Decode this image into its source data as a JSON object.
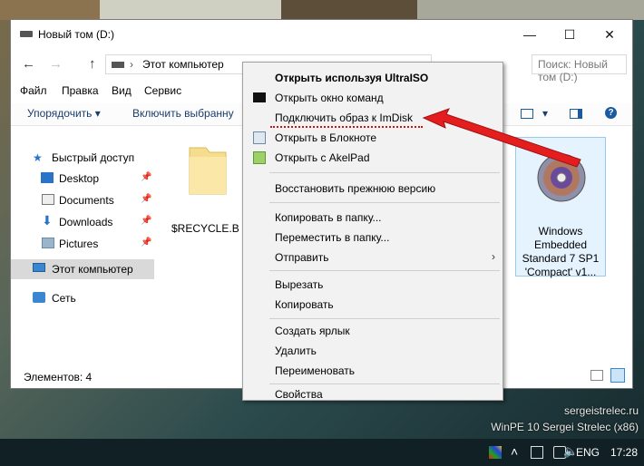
{
  "window": {
    "title": "Новый том (D:)",
    "controls": {
      "minimize": "—",
      "maximize": "☐",
      "close": "✕"
    }
  },
  "navigation": {
    "back": "←",
    "forward": "→",
    "up": "↑",
    "address_parts": [
      "Этот компьютер",
      "Новый том (D:)"
    ],
    "address_sep": "›",
    "search_placeholder": "Поиск: Новый том (D:)"
  },
  "menubar": [
    "Файл",
    "Правка",
    "Вид",
    "Сервис"
  ],
  "toolbar": {
    "organize": "Упорядочить",
    "include": "Включить выбранну"
  },
  "navpane": {
    "quick_access": "Быстрый доступ",
    "items": [
      {
        "label": "Desktop",
        "icon": "desktop-icon"
      },
      {
        "label": "Documents",
        "icon": "documents-icon"
      },
      {
        "label": "Downloads",
        "icon": "downloads-icon"
      },
      {
        "label": "Pictures",
        "icon": "pictures-icon"
      }
    ],
    "this_pc": "Этот компьютер",
    "network": "Сеть"
  },
  "content": {
    "folder_label": "$RECYCLE.B",
    "file_label_lines": [
      "Windows",
      "Embedded",
      "Standard 7 SP1",
      "'Compact' v1..."
    ]
  },
  "statusbar": {
    "items": "Элементов: 4"
  },
  "context_menu": {
    "items": [
      {
        "label": "Открыть используя UltraISO",
        "bold": true,
        "icon": null
      },
      {
        "label": "Открыть окно команд",
        "icon": "cmd-icon"
      },
      {
        "label": "Подключить образ к ImDisk",
        "icon": null,
        "highlighted": true
      },
      {
        "label": "Открыть в Блокноте",
        "icon": "notepad-icon"
      },
      {
        "label": "Открыть с AkelPad",
        "icon": "akelpad-icon"
      },
      {
        "label": "Восстановить прежнюю версию"
      },
      {
        "label": "Копировать в папку..."
      },
      {
        "label": "Переместить в папку..."
      },
      {
        "label": "Отправить",
        "submenu": true
      },
      {
        "label": "Вырезать"
      },
      {
        "label": "Копировать"
      },
      {
        "label": "Создать ярлык"
      },
      {
        "label": "Удалить"
      },
      {
        "label": "Переименовать"
      },
      {
        "label": "Свойства"
      }
    ]
  },
  "desktop": {
    "watermark_line1": "sergeistrelec.ru",
    "watermark_line2": "WinPE 10 Sergei Strelec (x86)"
  },
  "taskbar": {
    "lang": "ENG",
    "time": "17:28"
  },
  "colors": {
    "accent": "#1a3d6e",
    "arrow": "#e41e1e",
    "highlight_underline": "#cc1111",
    "selection": "#d9d9d9"
  }
}
